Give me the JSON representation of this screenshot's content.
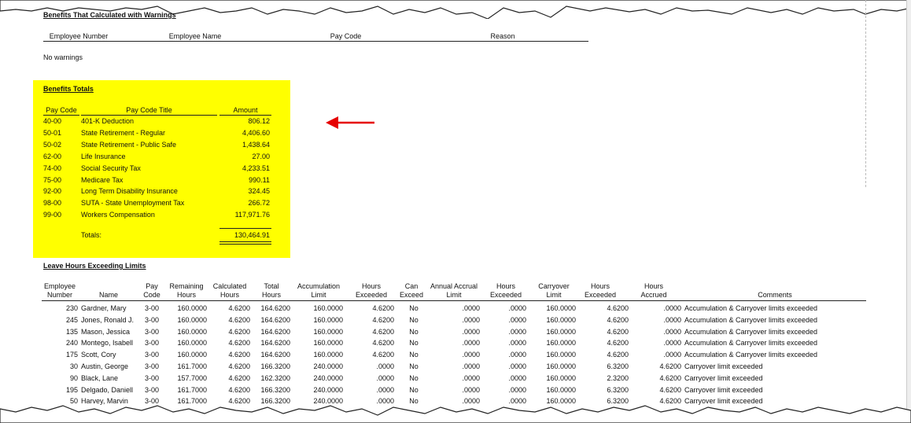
{
  "warnings_section": {
    "title": "Benefits That Calculated with Warnings",
    "headers": [
      "Employee Number",
      "Employee Name",
      "Pay Code",
      "Reason"
    ],
    "empty_text": "No warnings"
  },
  "benefits_totals": {
    "title": "Benefits Totals",
    "headers": [
      "Pay Code",
      "Pay Code Title",
      "Amount"
    ],
    "rows": [
      {
        "code": "40-00",
        "title": "401-K Deduction",
        "amount": "806.12"
      },
      {
        "code": "50-01",
        "title": "State Retirement - Regular",
        "amount": "4,406.60"
      },
      {
        "code": "50-02",
        "title": "State Retirement - Public Safe",
        "amount": "1,438.64"
      },
      {
        "code": "62-00",
        "title": "Life Insurance",
        "amount": "27.00"
      },
      {
        "code": "74-00",
        "title": "Social Security Tax",
        "amount": "4,233.51"
      },
      {
        "code": "75-00",
        "title": "Medicare Tax",
        "amount": "990.11"
      },
      {
        "code": "92-00",
        "title": "Long Term Disability Insurance",
        "amount": "324.45"
      },
      {
        "code": "98-00",
        "title": "SUTA - State Unemployment Tax",
        "amount": "266.72"
      },
      {
        "code": "99-00",
        "title": "Workers Compensation",
        "amount": "117,971.76"
      }
    ],
    "totals_label": "Totals:",
    "totals_amount": "130,464.91",
    "highlight_color": "#ffff00",
    "arrow_color": "#e60000"
  },
  "leave_section": {
    "title": "Leave Hours Exceeding Limits",
    "headers": [
      [
        "Employee",
        "Number"
      ],
      [
        "",
        "Name"
      ],
      [
        "Pay",
        "Code"
      ],
      [
        "Remaining",
        "Hours"
      ],
      [
        "Calculated",
        "Hours"
      ],
      [
        "Total",
        "Hours"
      ],
      [
        "Accumulation",
        "Limit"
      ],
      [
        "Hours",
        "Exceeded"
      ],
      [
        "Can",
        "Exceed"
      ],
      [
        "Annual Accrual",
        "Limit"
      ],
      [
        "Hours",
        "Exceeded"
      ],
      [
        "Carryover",
        "Limit"
      ],
      [
        "Hours",
        "Exceeded"
      ],
      [
        "Hours",
        "Accrued"
      ],
      [
        "",
        "Comments"
      ]
    ],
    "rows": [
      [
        "230",
        "Gardner, Mary",
        "3-00",
        "160.0000",
        "4.6200",
        "164.6200",
        "160.0000",
        "4.6200",
        "No",
        ".0000",
        ".0000",
        "160.0000",
        "4.6200",
        ".0000",
        "Accumulation & Carryover limits exceeded"
      ],
      [
        "245",
        "Jones, Ronald J.",
        "3-00",
        "160.0000",
        "4.6200",
        "164.6200",
        "160.0000",
        "4.6200",
        "No",
        ".0000",
        ".0000",
        "160.0000",
        "4.6200",
        ".0000",
        "Accumulation & Carryover limits exceeded"
      ],
      [
        "135",
        "Mason, Jessica",
        "3-00",
        "160.0000",
        "4.6200",
        "164.6200",
        "160.0000",
        "4.6200",
        "No",
        ".0000",
        ".0000",
        "160.0000",
        "4.6200",
        ".0000",
        "Accumulation & Carryover limits exceeded"
      ],
      [
        "240",
        "Montego, Isabell",
        "3-00",
        "160.0000",
        "4.6200",
        "164.6200",
        "160.0000",
        "4.6200",
        "No",
        ".0000",
        ".0000",
        "160.0000",
        "4.6200",
        ".0000",
        "Accumulation & Carryover limits exceeded"
      ],
      [
        "175",
        "Scott, Cory",
        "3-00",
        "160.0000",
        "4.6200",
        "164.6200",
        "160.0000",
        "4.6200",
        "No",
        ".0000",
        ".0000",
        "160.0000",
        "4.6200",
        ".0000",
        "Accumulation & Carryover limits exceeded"
      ],
      [
        "30",
        "Austin, George",
        "3-00",
        "161.7000",
        "4.6200",
        "166.3200",
        "240.0000",
        ".0000",
        "No",
        ".0000",
        ".0000",
        "160.0000",
        "6.3200",
        "4.6200",
        "Carryover limit exceeded"
      ],
      [
        "90",
        "Black, Lane",
        "3-00",
        "157.7000",
        "4.6200",
        "162.3200",
        "240.0000",
        ".0000",
        "No",
        ".0000",
        ".0000",
        "160.0000",
        "2.3200",
        "4.6200",
        "Carryover limit exceeded"
      ],
      [
        "195",
        "Delgado, Daniell",
        "3-00",
        "161.7000",
        "4.6200",
        "166.3200",
        "240.0000",
        ".0000",
        "No",
        ".0000",
        ".0000",
        "160.0000",
        "6.3200",
        "4.6200",
        "Carryover limit exceeded"
      ],
      [
        "50",
        "Harvey, Marvin",
        "3-00",
        "161.7000",
        "4.6200",
        "166.3200",
        "240.0000",
        ".0000",
        "No",
        ".0000",
        ".0000",
        "160.0000",
        "6.3200",
        "4.6200",
        "Carryover limit exceeded"
      ]
    ]
  }
}
